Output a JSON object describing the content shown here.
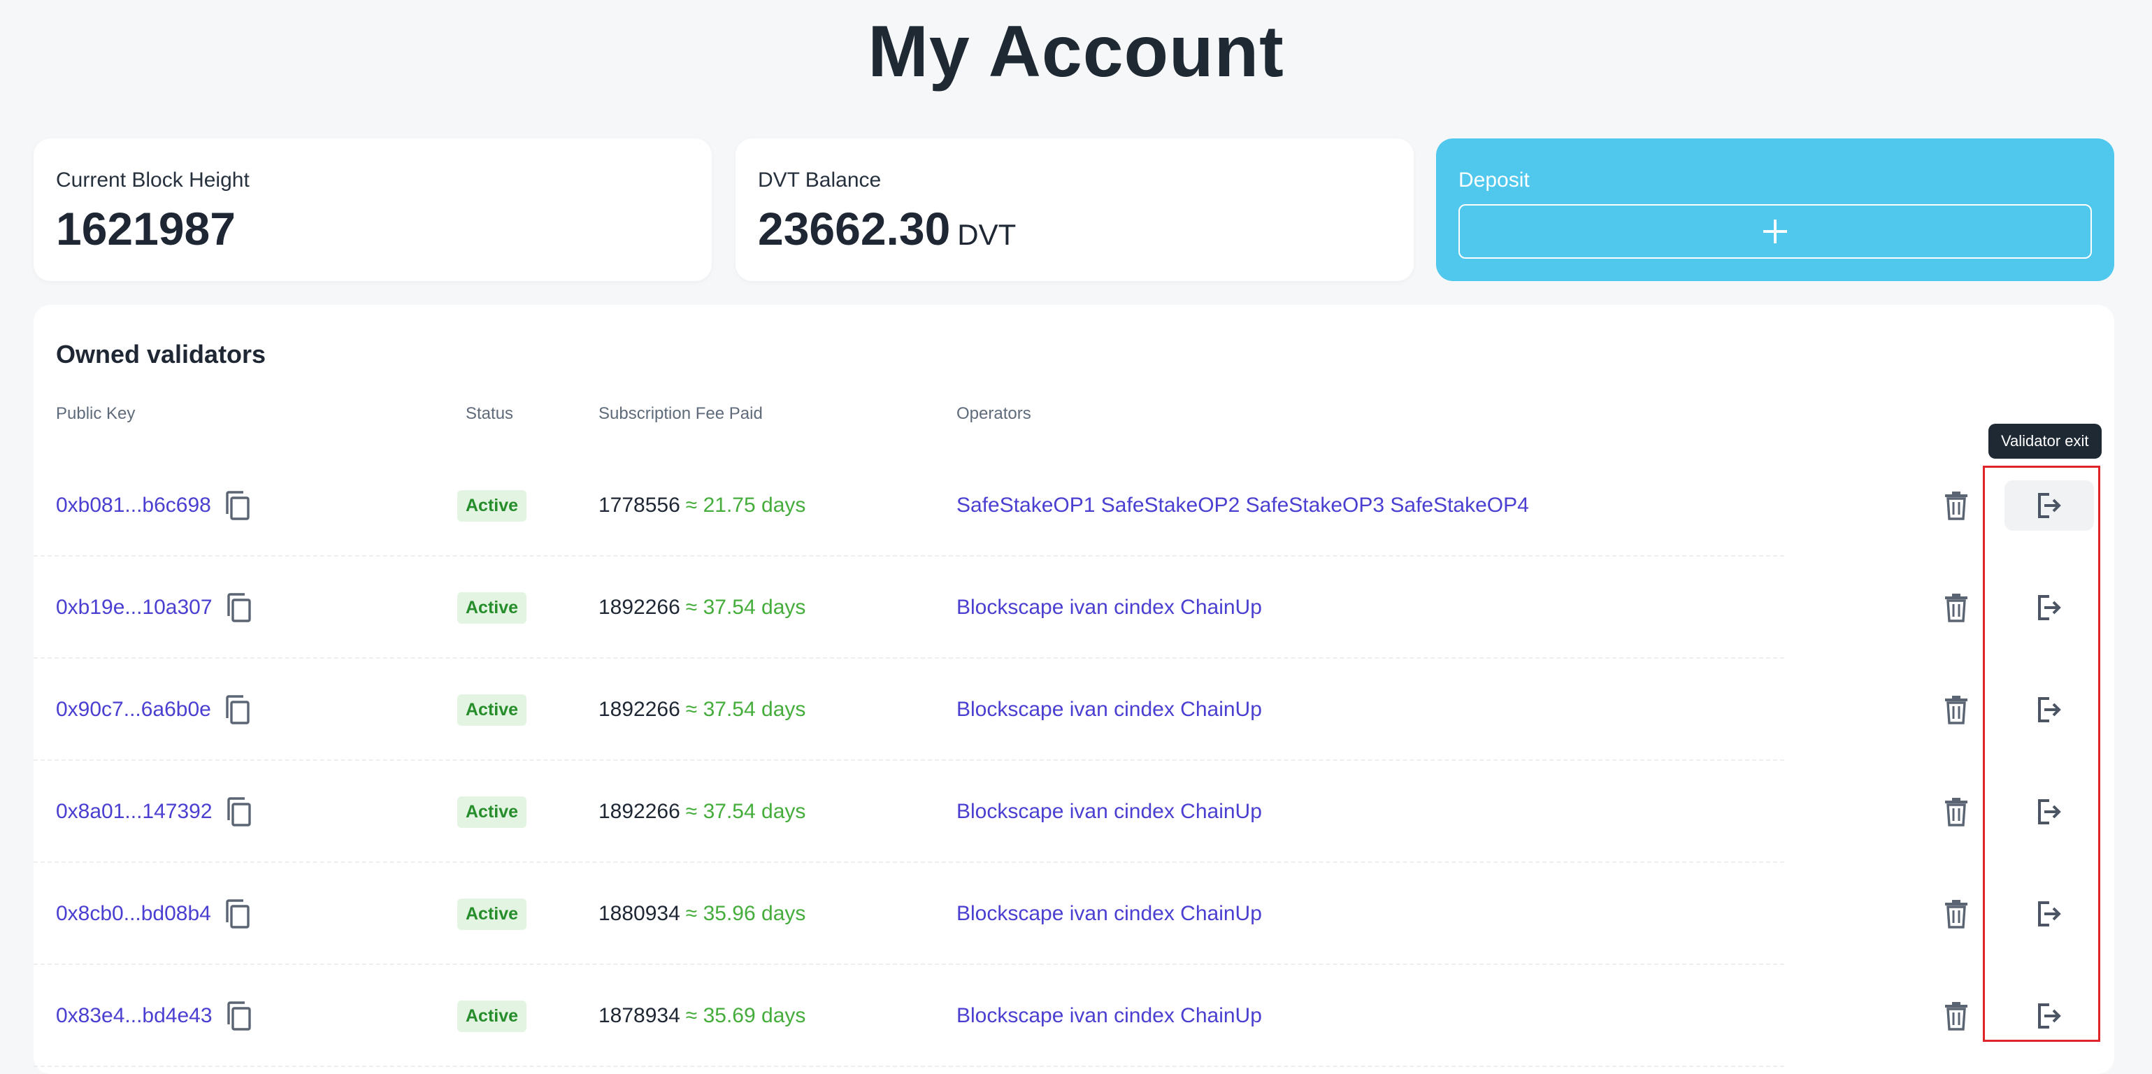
{
  "page": {
    "title": "My Account"
  },
  "cards": {
    "block_height": {
      "label": "Current Block Height",
      "value": "1621987"
    },
    "balance": {
      "label": "DVT Balance",
      "value": "23662.30",
      "unit": "DVT"
    },
    "deposit": {
      "label": "Deposit",
      "button_icon": "plus-icon"
    }
  },
  "validators": {
    "title": "Owned validators",
    "columns": [
      "Public Key",
      "Status",
      "Subscription Fee Paid",
      "Operators"
    ],
    "tooltip": "Validator exit",
    "rows": [
      {
        "public_key": "0xb081...b6c698",
        "status": "Active",
        "fee": "1778556",
        "duration": "≈ 21.75 days",
        "operators": "SafeStakeOP1 SafeStakeOP2 SafeStakeOP3 SafeStakeOP4"
      },
      {
        "public_key": "0xb19e...10a307",
        "status": "Active",
        "fee": "1892266",
        "duration": "≈ 37.54 days",
        "operators": "Blockscape ivan cindex ChainUp"
      },
      {
        "public_key": "0x90c7...6a6b0e",
        "status": "Active",
        "fee": "1892266",
        "duration": "≈ 37.54 days",
        "operators": "Blockscape ivan cindex ChainUp"
      },
      {
        "public_key": "0x8a01...147392",
        "status": "Active",
        "fee": "1892266",
        "duration": "≈ 37.54 days",
        "operators": "Blockscape ivan cindex ChainUp"
      },
      {
        "public_key": "0x8cb0...bd08b4",
        "status": "Active",
        "fee": "1880934",
        "duration": "≈ 35.96 days",
        "operators": "Blockscape ivan cindex ChainUp"
      },
      {
        "public_key": "0x83e4...bd4e43",
        "status": "Active",
        "fee": "1878934",
        "duration": "≈ 35.69 days",
        "operators": "Blockscape ivan cindex ChainUp"
      }
    ]
  },
  "colors": {
    "accent": "#50c8ee",
    "link": "#4a3fd1",
    "active_text": "#268d2b",
    "active_bg": "#e4f4e2",
    "days": "#45ad3b",
    "highlight": "#e0242b"
  }
}
